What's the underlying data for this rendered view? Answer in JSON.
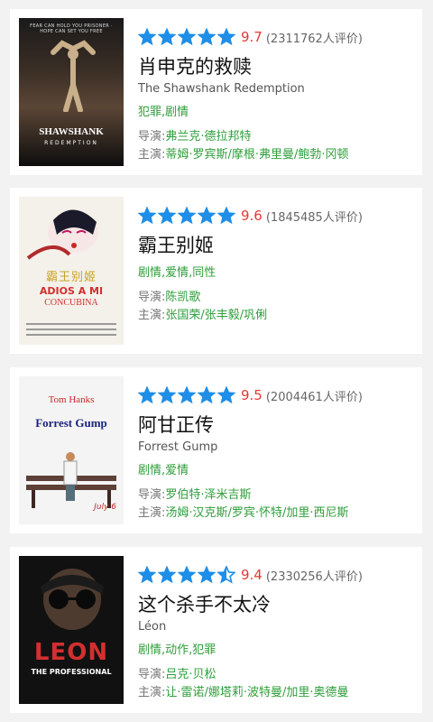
{
  "movies": [
    {
      "stars_full": 5,
      "stars_half": 0,
      "score": "9.7",
      "votes": "(2311762人评价)",
      "title": "肖申克的救赎",
      "original_title": "The Shawshank Redemption",
      "genres": "犯罪,剧情",
      "director_label": "导演:",
      "director": "弗兰克·德拉邦特",
      "cast_label": "主演:",
      "cast": "蒂姆·罗宾斯/摩根·弗里曼/鲍勃·冈顿",
      "poster_text_top": "SHAWSHANK",
      "poster_text_sub": "REDEMPTION",
      "poster_text_bottom": "FEAR CAN HOLD YOU PRISONER · HOPE CAN SET YOU FREE"
    },
    {
      "stars_full": 5,
      "stars_half": 0,
      "score": "9.6",
      "votes": "(1845485人评价)",
      "title": "霸王别姬",
      "original_title": "",
      "genres": "剧情,爱情,同性",
      "director_label": "导演:",
      "director": "陈凯歌",
      "cast_label": "主演:",
      "cast": "张国荣/张丰毅/巩俐",
      "poster_text_top": "霸王别姬",
      "poster_text_sub": "ADIOS A MI",
      "poster_text_bottom": "CONCUBINA"
    },
    {
      "stars_full": 5,
      "stars_half": 0,
      "score": "9.5",
      "votes": "(2004461人评价)",
      "title": "阿甘正传",
      "original_title": "Forrest Gump",
      "genres": "剧情,爱情",
      "director_label": "导演:",
      "director": "罗伯特·泽米吉斯",
      "cast_label": "主演:",
      "cast": "汤姆·汉克斯/罗宾·怀特/加里·西尼斯",
      "poster_text_top": "Tom Hanks",
      "poster_text_sub": "Forrest Gump",
      "poster_text_bottom": "July 6"
    },
    {
      "stars_full": 4,
      "stars_half": 1,
      "score": "9.4",
      "votes": "(2330256人评价)",
      "title": "这个杀手不太冷",
      "original_title": "Léon",
      "genres": "剧情,动作,犯罪",
      "director_label": "导演:",
      "director": "吕克·贝松",
      "cast_label": "主演:",
      "cast": "让·雷诺/娜塔莉·波特曼/加里·奥德曼",
      "poster_text_top": "LEON",
      "poster_text_sub": "THE PROFESSIONAL",
      "poster_text_bottom": ""
    }
  ],
  "colors": {
    "star": "#1e8ee8",
    "score": "#e53935",
    "accent_green": "#2e9e3a"
  }
}
